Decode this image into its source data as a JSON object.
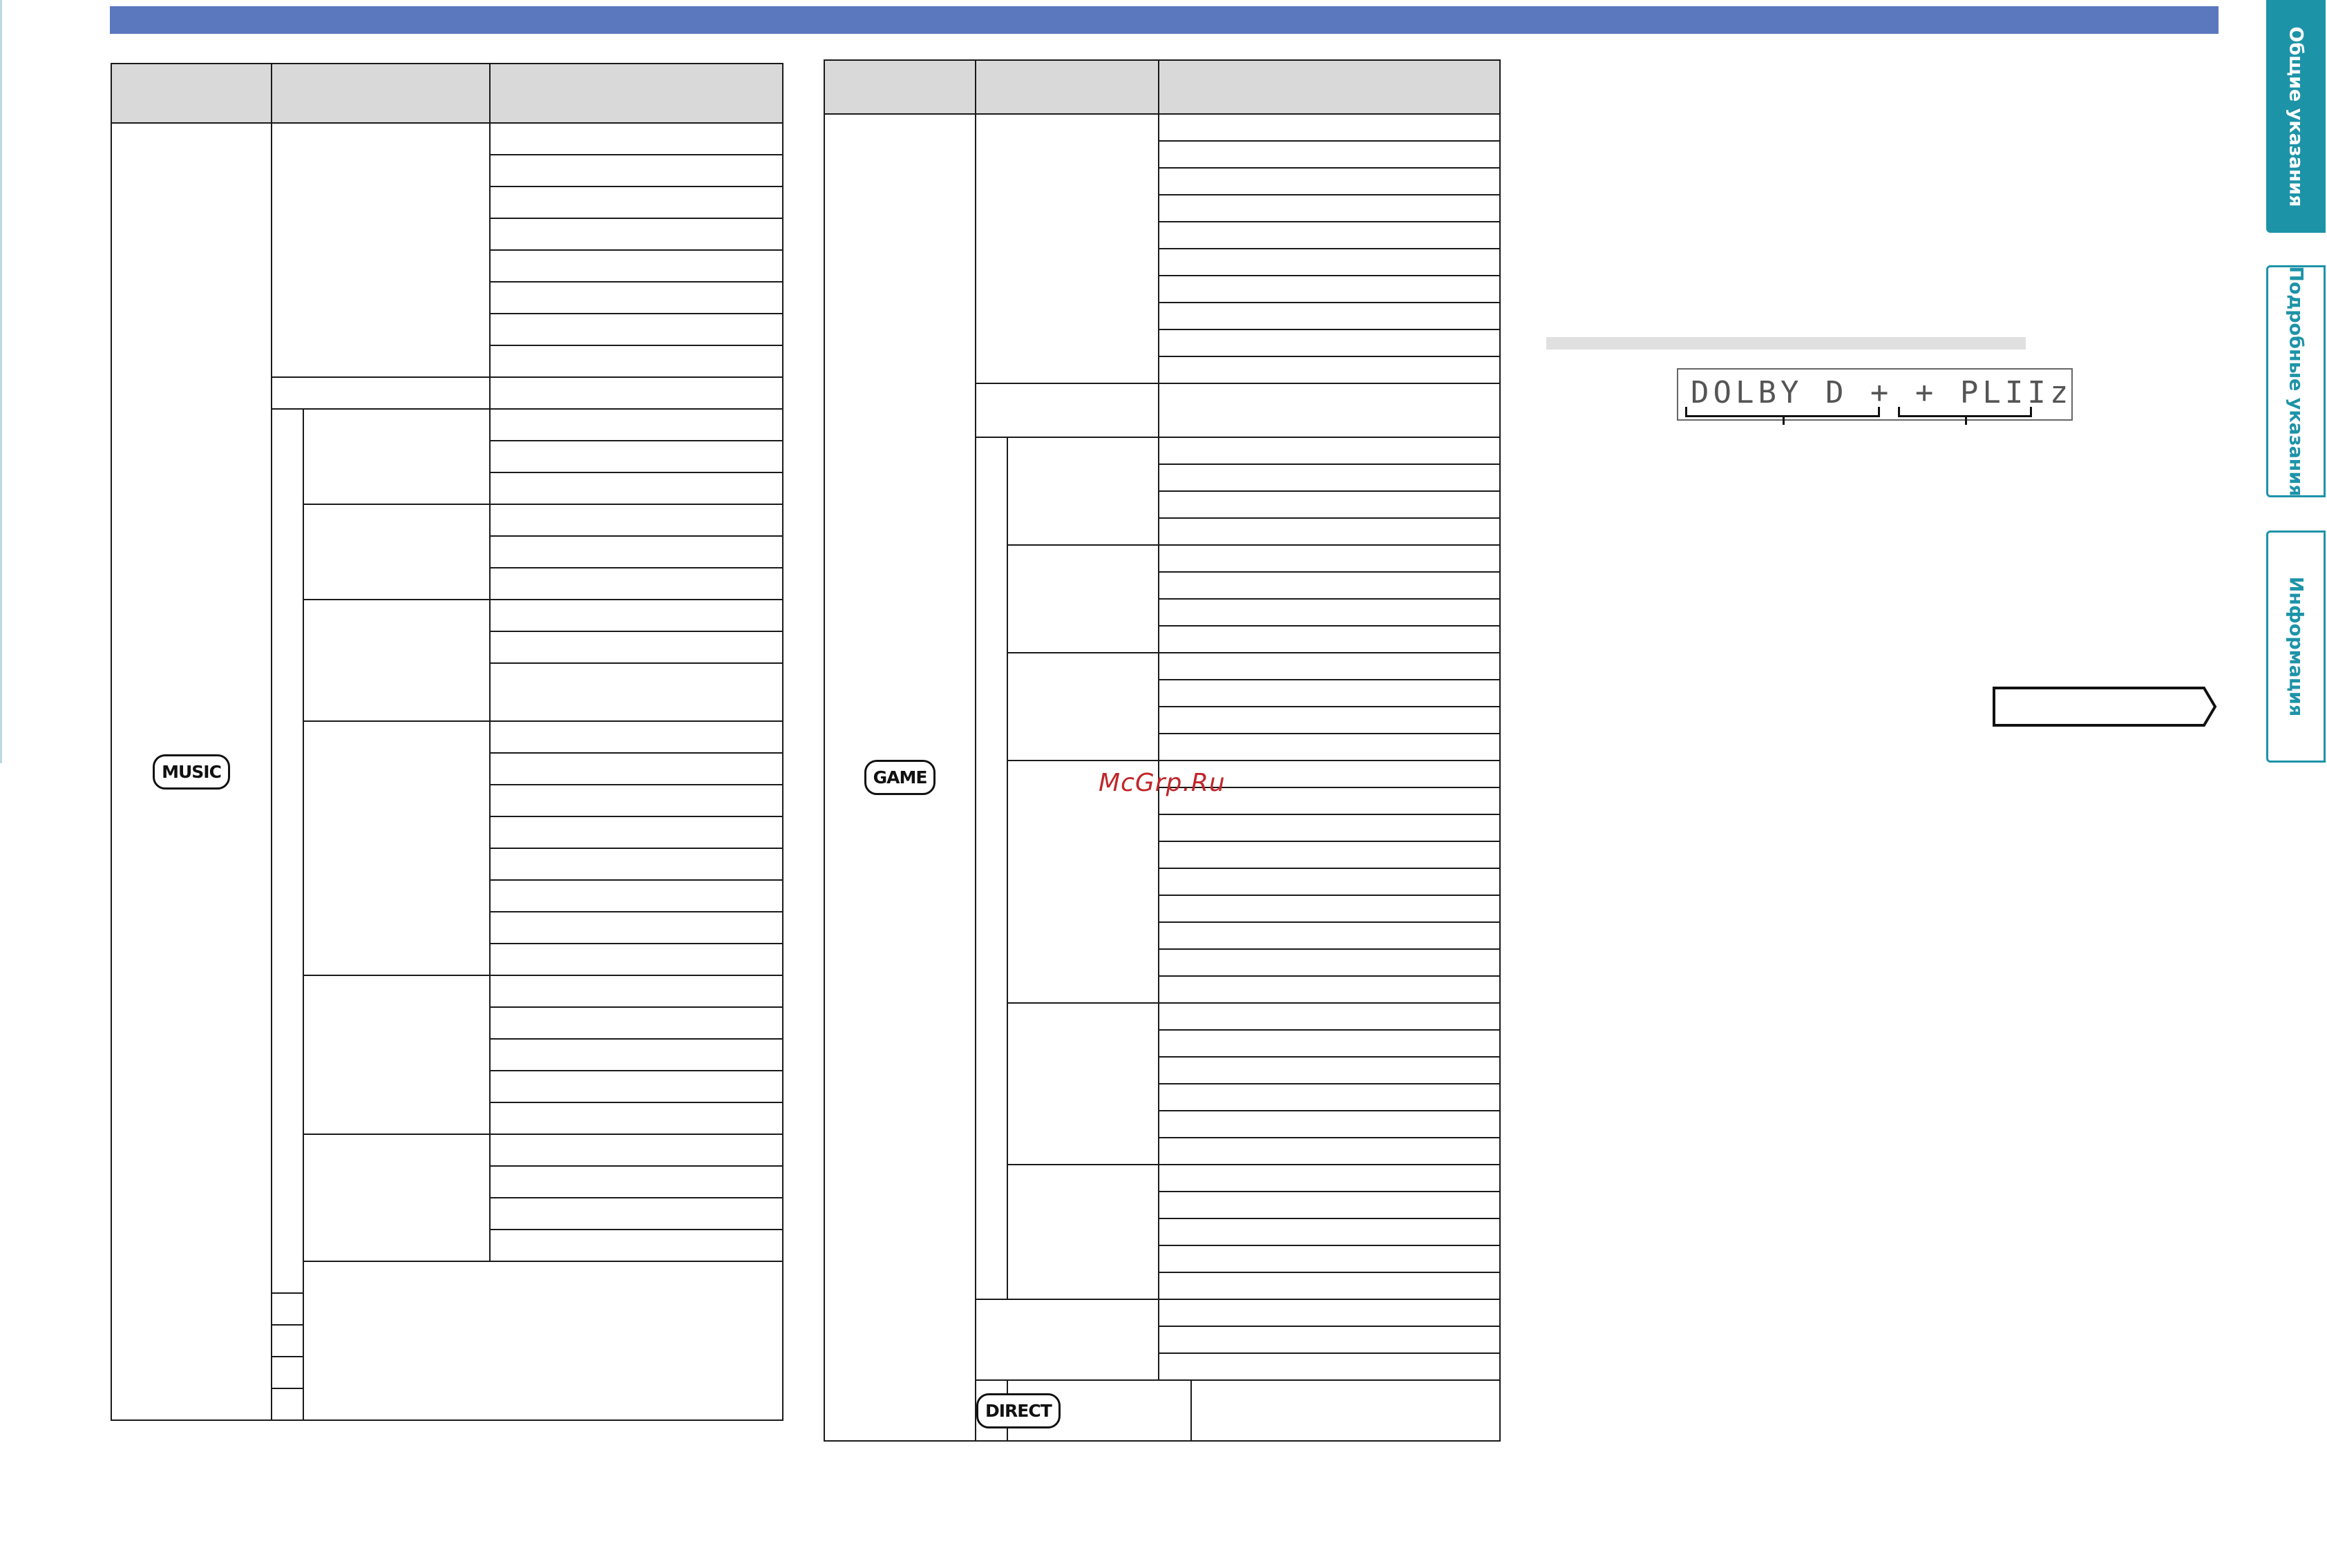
{
  "watermark": "McGrp.Ru",
  "badges": {
    "music": "MUSIC",
    "game": "GAME",
    "direct": "DIRECT"
  },
  "display": {
    "text": "DOLBY D + + PLIIz"
  },
  "side_tabs": [
    {
      "label": "Общие указания",
      "active": true
    },
    {
      "label": "Подробные указания",
      "active": false
    },
    {
      "label": "Информация",
      "active": false
    }
  ],
  "colors": {
    "header_bar": "#5b78bf",
    "tab_accent": "#1d93a8",
    "watermark": "#c0262a"
  }
}
